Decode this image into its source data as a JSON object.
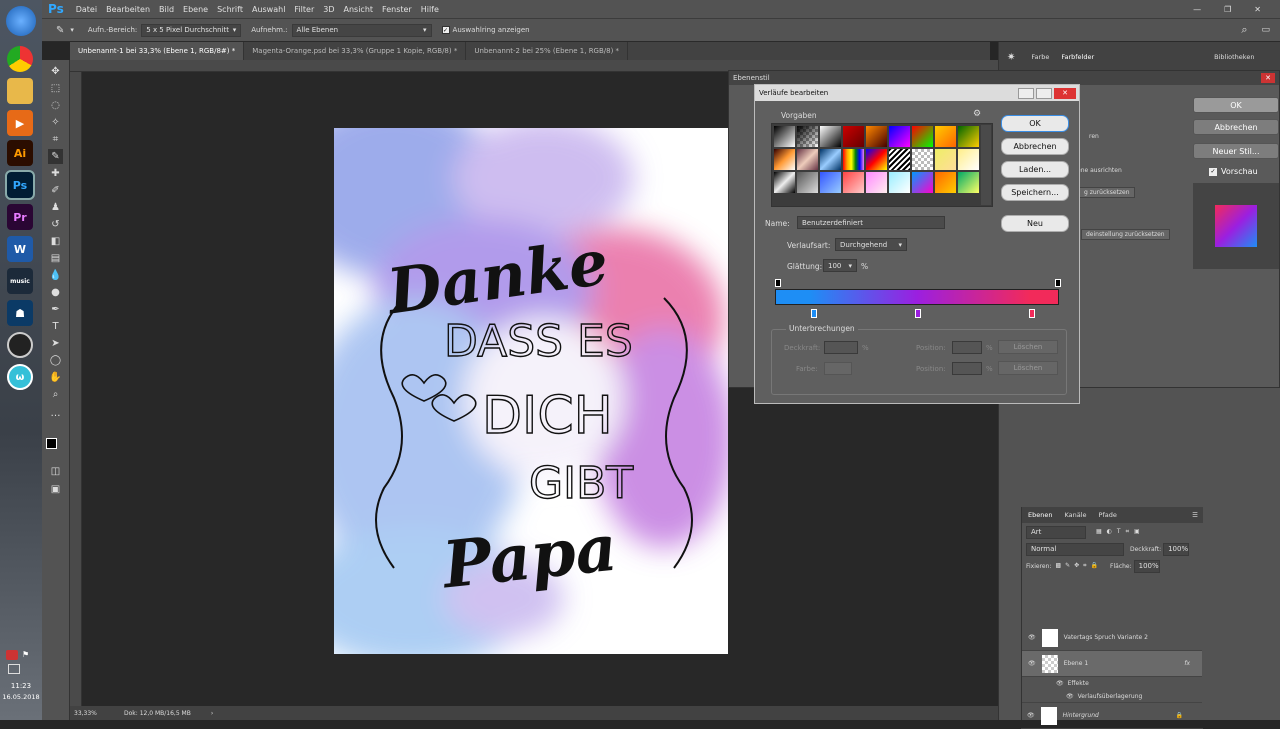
{
  "app": {
    "logo": "Ps"
  },
  "menu": [
    "Datei",
    "Bearbeiten",
    "Bild",
    "Ebene",
    "Schrift",
    "Auswahl",
    "Filter",
    "3D",
    "Ansicht",
    "Fenster",
    "Hilfe"
  ],
  "options": {
    "sample_label": "Aufn.-Bereich:",
    "sample_value": "5 x 5 Pixel Durchschnitt",
    "sample_from_label": "Aufnehm.:",
    "sample_from_value": "Alle Ebenen",
    "ring_label": "Auswahlring anzeigen"
  },
  "tabs": [
    "Unbenannt-1 bei 33,3% (Ebene 1, RGB/8#) *",
    "Magenta-Orange.psd bei 33,3% (Gruppe 1 Kopie, RGB/8) *",
    "Unbenannt-2 bei 25% (Ebene 1, RGB/8) *"
  ],
  "status": {
    "zoom": "33,33%",
    "doc": "Dok: 12,0 MB/16,5 MB"
  },
  "clock": {
    "time": "11:23",
    "date": "16.05.2018"
  },
  "taskbar": {
    "icons": [
      "windows-start-icon",
      "chrome-icon",
      "folder-icon",
      "media-player-icon",
      "illustrator-icon",
      "photoshop-icon",
      "premiere-icon",
      "word-icon",
      "amazon-music-icon",
      "kindle-icon",
      "obs-icon",
      "app-w-icon"
    ],
    "labels": {
      "ai": "Ai",
      "ps": "Ps",
      "pr": "Pr",
      "w": "W",
      "music": "music"
    }
  },
  "artwork": {
    "line1": "Danke",
    "line2": "DASS ES",
    "line3": "DICH",
    "line4": "GIBT",
    "line5": "Papa"
  },
  "ebenenstil": {
    "title": "Ebenenstil",
    "ok": "OK",
    "cancel": "Abbrechen",
    "new_style": "Neuer Stil...",
    "preview": "Vorschau",
    "p1": "ren",
    "p2": "ene ausrichten",
    "p3": "g zurücksetzen",
    "p4": "deinstellung zurücksetzen"
  },
  "verlauf": {
    "title": "Verläufe bearbeiten",
    "presets": "Vorgaben",
    "ok": "OK",
    "cancel": "Abbrechen",
    "load": "Laden...",
    "save": "Speichern...",
    "new": "Neu",
    "name_label": "Name:",
    "name_value": "Benutzerdefiniert",
    "type_label": "Verlaufsart:",
    "type_value": "Durchgehend",
    "smooth_label": "Glättung:",
    "smooth_value": "100",
    "smooth_unit": "%",
    "stops_title": "Unterbrechungen",
    "opacity_label": "Deckkraft:",
    "position_label": "Position:",
    "delete": "Löschen",
    "color_label": "Farbe:",
    "pct": "%"
  },
  "panels": {
    "tab_color": "Farbe",
    "tab_swatches": "Farbfelder",
    "libraries": "Bibliotheken",
    "layers_tabs": [
      "Ebenen",
      "Kanäle",
      "Pfade"
    ],
    "search_placeholder": "Art",
    "blend": "Normal",
    "opacity_label": "Deckkraft:",
    "opacity_value": "100%",
    "lock_label": "Fixieren:",
    "fill_label": "Fläche:",
    "fill_value": "100%"
  },
  "layers": [
    {
      "name": "Vatertags Spruch Variante 2"
    },
    {
      "name": "Ebene 1",
      "fx": "fx"
    },
    {
      "name": "Effekte"
    },
    {
      "name": "Verlaufsüberlagerung"
    },
    {
      "name": "Hintergrund"
    }
  ],
  "colors": {
    "grad_start": "#1e8ef5",
    "grad_mid": "#9b1fe0",
    "grad_end": "#f22a5a"
  }
}
